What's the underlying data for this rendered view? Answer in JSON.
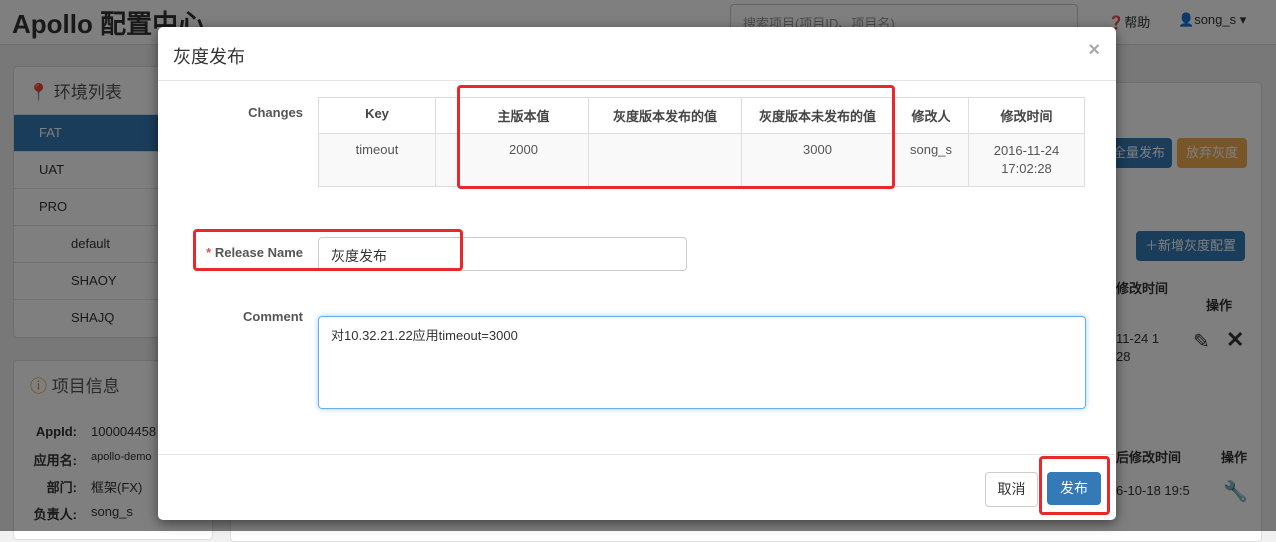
{
  "header": {
    "title": "Apollo 配置中心",
    "search_placeholder": "搜索项目(项目ID、项目名)",
    "help": "帮助",
    "user": "song_s"
  },
  "env_panel": {
    "title": "环境列表",
    "items": [
      {
        "label": "FAT"
      },
      {
        "label": "UAT"
      },
      {
        "label": "PRO"
      },
      {
        "label": "default"
      },
      {
        "label": "SHAOY"
      },
      {
        "label": "SHAJQ"
      }
    ]
  },
  "info_panel": {
    "title": "项目信息",
    "rows": [
      {
        "label": "AppId:",
        "value": "100004458"
      },
      {
        "label": "应用名:",
        "value": "apollo-demo"
      },
      {
        "label": "部门:",
        "value": "框架(FX)"
      },
      {
        "label": "负责人:",
        "value": "song_s"
      }
    ]
  },
  "background": {
    "full_release": "全量发布",
    "abandon_gray": "放弃灰度",
    "add_gray_config": "新增灰度配置",
    "col_modified_time": "修改时间",
    "col_ops": "操作",
    "row_time": "11-24 1",
    "row_time2": "28",
    "col_last_modified": "后修改时间",
    "row2_time": "6-10-18 19:5"
  },
  "modal": {
    "title": "灰度发布",
    "changes_label": "Changes",
    "columns": [
      "Key",
      "",
      "主版本值",
      "灰度版本发布的值",
      "灰度版本未发布的值",
      "修改人",
      "修改时间"
    ],
    "rows": [
      [
        "timeout",
        "",
        "2000",
        "",
        "3000",
        "song_s",
        "2016-11-24 17:02:28"
      ]
    ],
    "release_name_required": "*",
    "release_name_label": "Release Name",
    "release_name_value": "灰度发布",
    "comment_label": "Comment",
    "comment_value": "对10.32.21.22应用timeout=3000",
    "cancel": "取消",
    "publish": "发布"
  },
  "colors": {
    "primary": "#337ab7",
    "warning": "#f0ad4e",
    "highlight": "#e8282b"
  }
}
